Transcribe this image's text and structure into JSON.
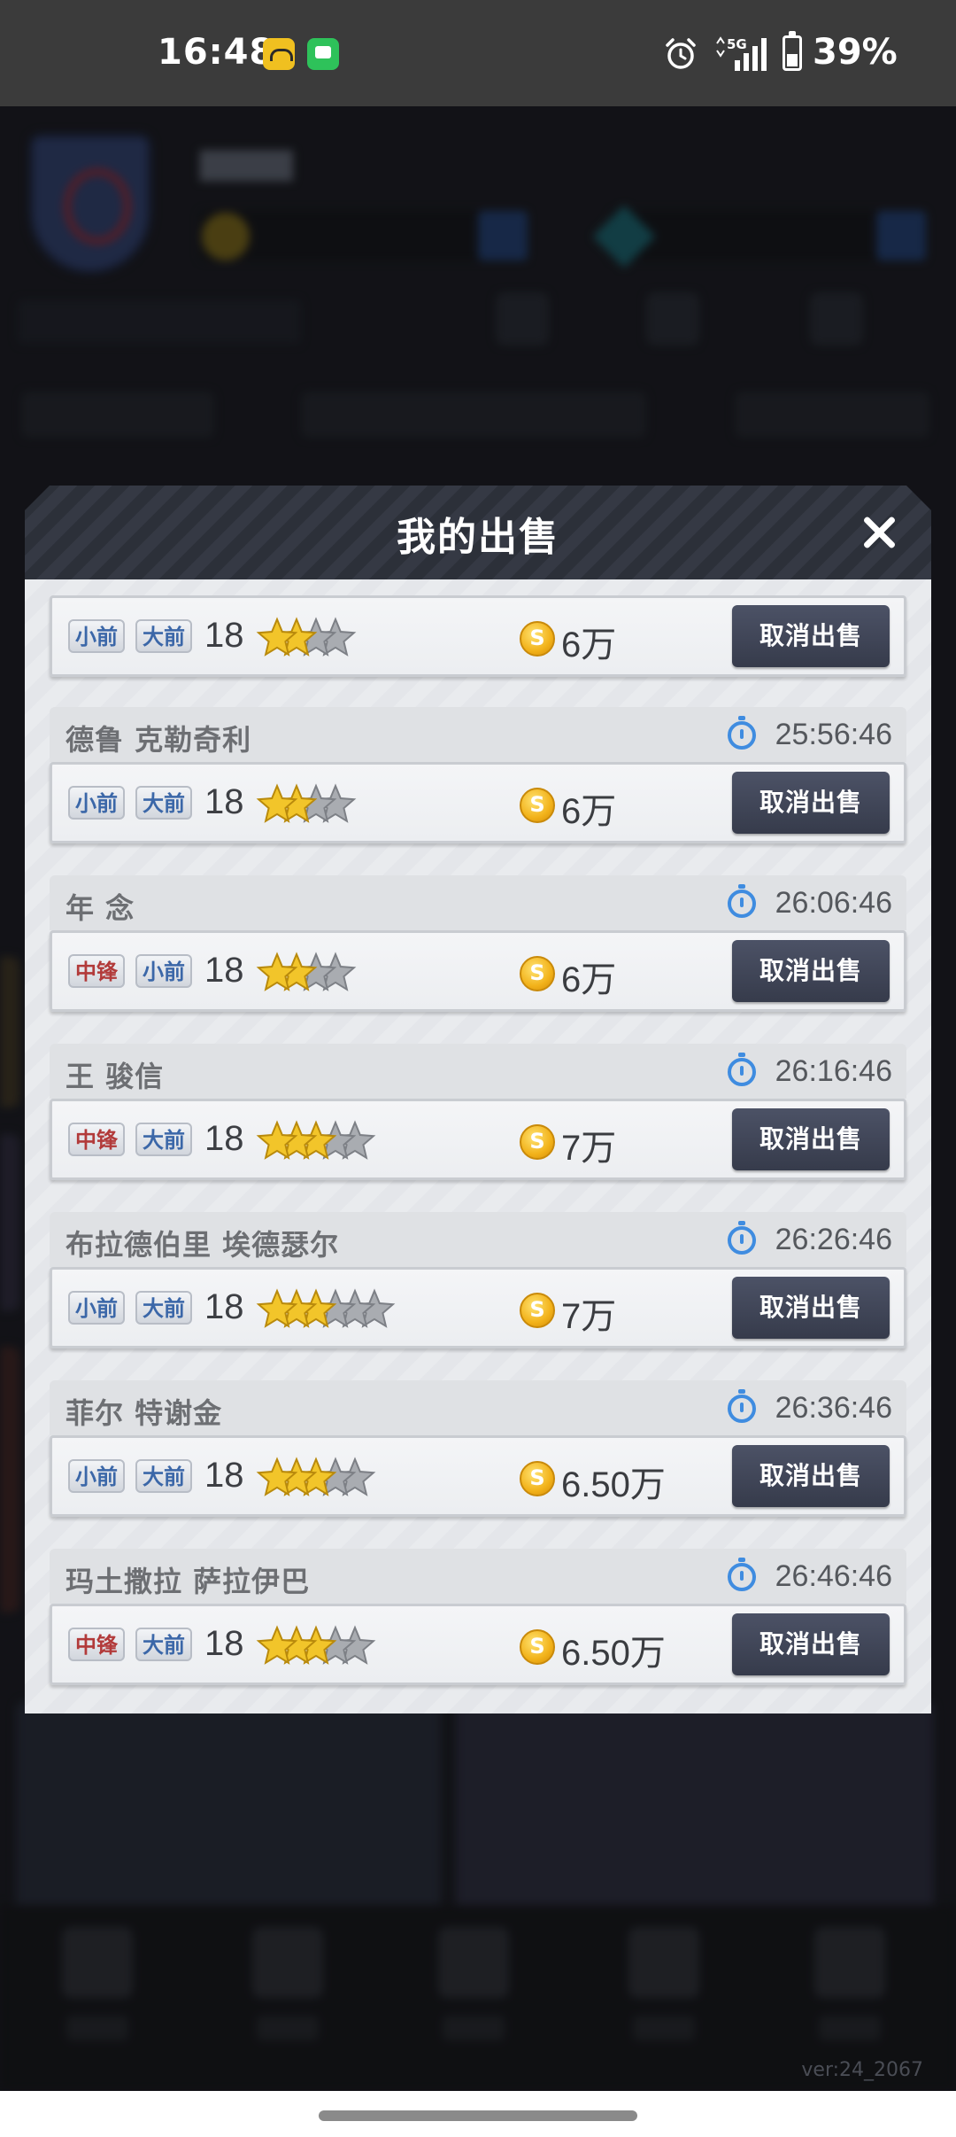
{
  "status_bar": {
    "time": "16:48",
    "battery": "39%",
    "network": "5G",
    "icons": [
      "app-notification-icon",
      "message-notification-icon",
      "alarm-icon",
      "signal-icon",
      "battery-icon"
    ]
  },
  "background": {
    "version": "ver:24_2067"
  },
  "modal": {
    "title": "我的出售",
    "first_row": {
      "positions": [
        {
          "label": "小前",
          "color": "blue"
        },
        {
          "label": "大前",
          "color": "blue"
        }
      ],
      "rating": "18",
      "stars_gold": 2,
      "stars_total": 4,
      "price": "6万",
      "button": "取消出售"
    },
    "entries": [
      {
        "name": "德鲁 克勒奇利",
        "timer": "25:56:46",
        "positions": [
          {
            "label": "小前",
            "color": "blue"
          },
          {
            "label": "大前",
            "color": "blue"
          }
        ],
        "rating": "18",
        "stars_gold": 2,
        "stars_total": 4,
        "price": "6万",
        "button": "取消出售"
      },
      {
        "name": "年 念",
        "timer": "26:06:46",
        "positions": [
          {
            "label": "中锋",
            "color": "red"
          },
          {
            "label": "小前",
            "color": "blue"
          }
        ],
        "rating": "18",
        "stars_gold": 2,
        "stars_total": 4,
        "price": "6万",
        "button": "取消出售"
      },
      {
        "name": "王 骏信",
        "timer": "26:16:46",
        "positions": [
          {
            "label": "中锋",
            "color": "red"
          },
          {
            "label": "大前",
            "color": "blue"
          }
        ],
        "rating": "18",
        "stars_gold": 3,
        "stars_total": 5,
        "price": "7万",
        "button": "取消出售"
      },
      {
        "name": "布拉德伯里 埃德瑟尔",
        "timer": "26:26:46",
        "positions": [
          {
            "label": "小前",
            "color": "blue"
          },
          {
            "label": "大前",
            "color": "blue"
          }
        ],
        "rating": "18",
        "stars_gold": 3,
        "stars_total": 6,
        "price": "7万",
        "button": "取消出售"
      },
      {
        "name": "菲尔 特谢金",
        "timer": "26:36:46",
        "positions": [
          {
            "label": "小前",
            "color": "blue"
          },
          {
            "label": "大前",
            "color": "blue"
          }
        ],
        "rating": "18",
        "stars_gold": 3,
        "stars_total": 5,
        "price": "6.50万",
        "button": "取消出售"
      },
      {
        "name": "玛土撒拉 萨拉伊巴",
        "timer": "26:46:46",
        "positions": [
          {
            "label": "中锋",
            "color": "red"
          },
          {
            "label": "大前",
            "color": "blue"
          }
        ],
        "rating": "18",
        "stars_gold": 3,
        "stars_total": 5,
        "price": "6.50万",
        "button": "取消出售"
      }
    ]
  },
  "colors": {
    "gold_star": "#f2c52a",
    "gray_star": "#a9acb1",
    "button_bg": "#3f4456",
    "timer_blue": "#3f8ce0",
    "badge_blue_text": "#3b67a8",
    "badge_red_text": "#b23a3a"
  }
}
